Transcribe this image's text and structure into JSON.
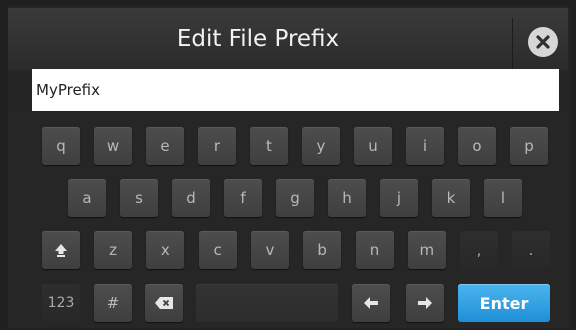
{
  "dialog": {
    "title": "Edit File Prefix",
    "close_icon": "close-circle-icon"
  },
  "input": {
    "value": "MyPrefix"
  },
  "keyboard": {
    "row1": [
      "q",
      "w",
      "e",
      "r",
      "t",
      "y",
      "u",
      "i",
      "o",
      "p"
    ],
    "row2": [
      "a",
      "s",
      "d",
      "f",
      "g",
      "h",
      "j",
      "k",
      "l"
    ],
    "row3": [
      "z",
      "x",
      "c",
      "v",
      "b",
      "n",
      "m"
    ],
    "comma": ",",
    "period": ".",
    "mode_label": "123",
    "symbol_label": "#",
    "enter_label": "Enter",
    "icons": {
      "shift": "shift-icon",
      "backspace": "backspace-icon",
      "left": "arrow-left-icon",
      "right": "arrow-right-icon"
    }
  },
  "colors": {
    "enter_key": "#2a9ae0",
    "background": "#252525"
  }
}
